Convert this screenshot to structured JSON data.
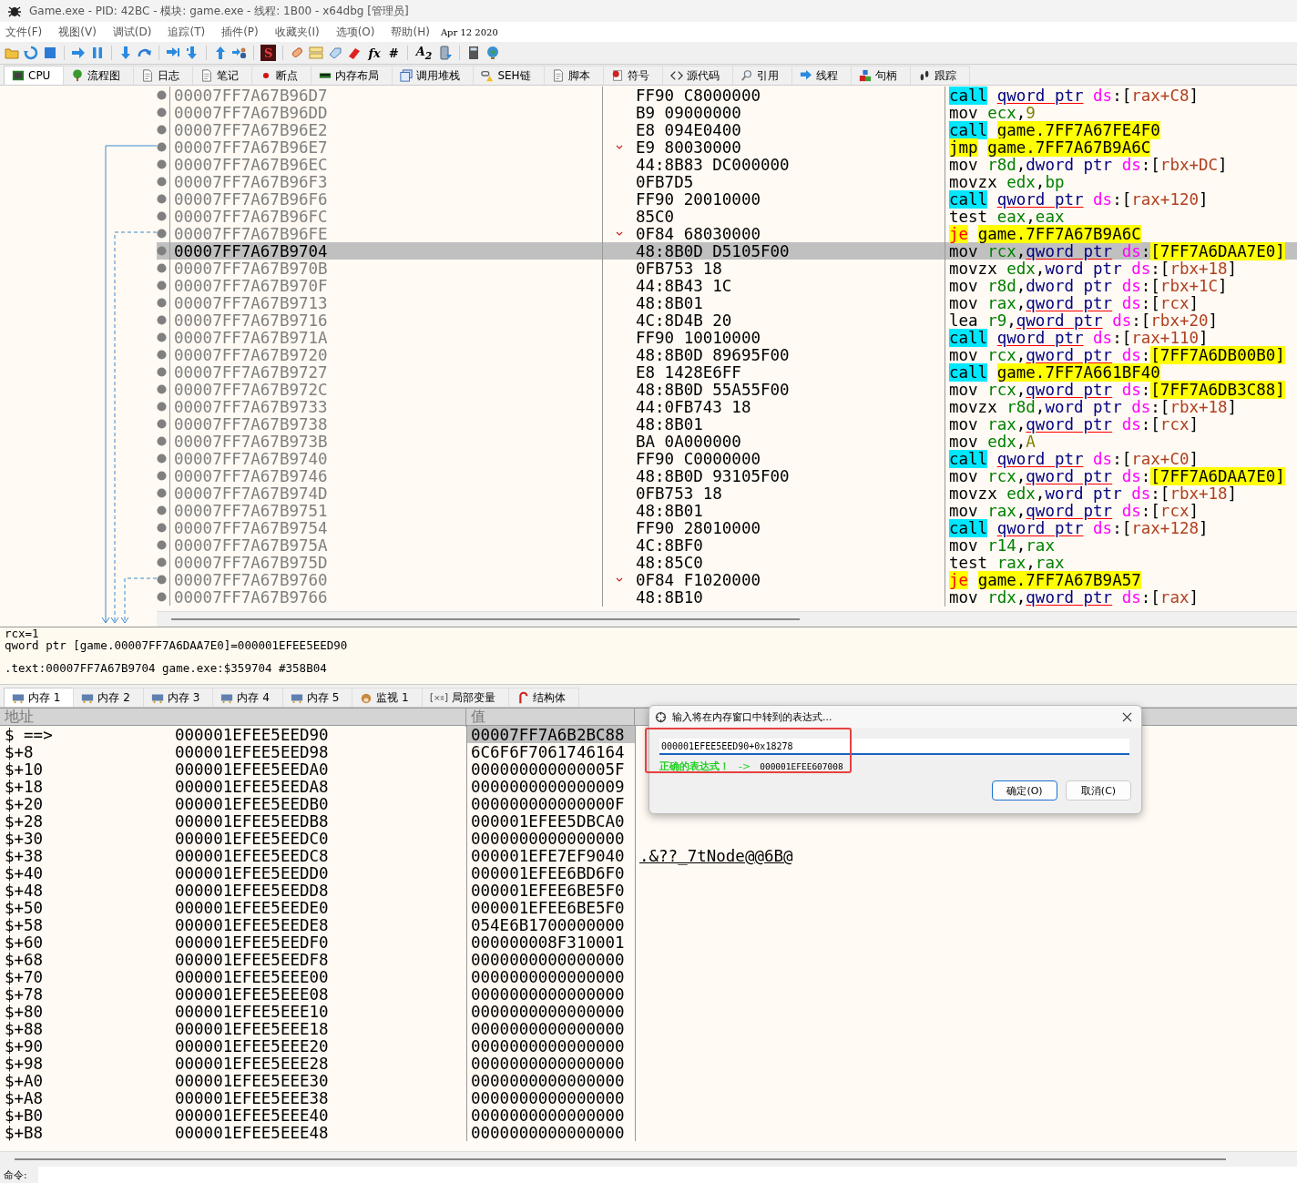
{
  "window": {
    "title": "Game.exe - PID: 42BC - 模块: game.exe - 线程: 1B00 - x64dbg [管理员]"
  },
  "menu": {
    "items": [
      "文件(F)",
      "视图(V)",
      "调试(D)",
      "追踪(T)",
      "插件(P)",
      "收藏夹(I)",
      "选项(O)",
      "帮助(H)"
    ],
    "build_date": "Apr 12 2020"
  },
  "toolbar": {
    "labels": [
      "S",
      "fx",
      "#",
      "A$_{2}$"
    ]
  },
  "tabs": [
    {
      "label": "CPU",
      "selected": true
    },
    {
      "label": "流程图",
      "selected": false
    },
    {
      "label": "日志",
      "selected": false
    },
    {
      "label": "笔记",
      "selected": false
    },
    {
      "label": "断点",
      "selected": false
    },
    {
      "label": "内存布局",
      "selected": false
    },
    {
      "label": "调用堆栈",
      "selected": false
    },
    {
      "label": "SEH链",
      "selected": false
    },
    {
      "label": "脚本",
      "selected": false
    },
    {
      "label": "符号",
      "selected": false
    },
    {
      "label": "源代码",
      "selected": false
    },
    {
      "label": "引用",
      "selected": false
    },
    {
      "label": "线程",
      "selected": false
    },
    {
      "label": "句柄",
      "selected": false
    },
    {
      "label": "跟踪",
      "selected": false
    }
  ],
  "disassembly": {
    "rows": [
      {
        "address": "00007FF7A67B96D7",
        "bytes": "FF90 C8000000",
        "jump_mark": false,
        "selected": false,
        "ins": [
          {
            "kind": "call",
            "text": "call"
          },
          {
            "kind": "qptr",
            "text": "qword ptr"
          },
          {
            "kind": "seg",
            "text": "ds"
          },
          {
            "kind": "p",
            "text": ":["
          },
          {
            "kind": "mem",
            "text": "rax+C8"
          },
          {
            "kind": "p",
            "text": "]"
          }
        ]
      },
      {
        "address": "00007FF7A67B96DD",
        "bytes": "B9 09000000",
        "jump_mark": false,
        "selected": false,
        "ins": [
          {
            "kind": "mn",
            "text": "mov"
          },
          {
            "kind": "reg",
            "text": "ecx"
          },
          {
            "kind": "p",
            "text": ","
          },
          {
            "kind": "imm",
            "text": "9"
          }
        ]
      },
      {
        "address": "00007FF7A67B96E2",
        "bytes": "E8 094E0400",
        "jump_mark": false,
        "selected": false,
        "ins": [
          {
            "kind": "call",
            "text": "call"
          },
          {
            "kind": "addr",
            "text": "game.7FF7A67FE4F0"
          }
        ]
      },
      {
        "address": "00007FF7A67B96E7",
        "bytes": "E9 80030000",
        "jump_mark": true,
        "selected": false,
        "ins": [
          {
            "kind": "jmp",
            "text": "jmp"
          },
          {
            "kind": "addr",
            "text": "game.7FF7A67B9A6C"
          }
        ]
      },
      {
        "address": "00007FF7A67B96EC",
        "bytes": "44:8B83 DC000000",
        "jump_mark": false,
        "selected": false,
        "ins": [
          {
            "kind": "mn",
            "text": "mov"
          },
          {
            "kind": "reg",
            "text": "r8d"
          },
          {
            "kind": "p",
            "text": ","
          },
          {
            "kind": "ptr",
            "text": "dword ptr"
          },
          {
            "kind": "seg",
            "text": "ds"
          },
          {
            "kind": "p",
            "text": ":["
          },
          {
            "kind": "mem",
            "text": "rbx+DC"
          },
          {
            "kind": "p",
            "text": "]"
          }
        ]
      },
      {
        "address": "00007FF7A67B96F3",
        "bytes": "0FB7D5",
        "jump_mark": false,
        "selected": false,
        "ins": [
          {
            "kind": "mn",
            "text": "movzx"
          },
          {
            "kind": "reg",
            "text": "edx"
          },
          {
            "kind": "p",
            "text": ","
          },
          {
            "kind": "reg",
            "text": "bp"
          }
        ]
      },
      {
        "address": "00007FF7A67B96F6",
        "bytes": "FF90 20010000",
        "jump_mark": false,
        "selected": false,
        "ins": [
          {
            "kind": "call",
            "text": "call"
          },
          {
            "kind": "qptr",
            "text": "qword ptr"
          },
          {
            "kind": "seg",
            "text": "ds"
          },
          {
            "kind": "p",
            "text": ":["
          },
          {
            "kind": "mem",
            "text": "rax+120"
          },
          {
            "kind": "p",
            "text": "]"
          }
        ]
      },
      {
        "address": "00007FF7A67B96FC",
        "bytes": "85C0",
        "jump_mark": false,
        "selected": false,
        "ins": [
          {
            "kind": "mn",
            "text": "test"
          },
          {
            "kind": "reg",
            "text": "eax"
          },
          {
            "kind": "p",
            "text": ","
          },
          {
            "kind": "reg",
            "text": "eax"
          }
        ]
      },
      {
        "address": "00007FF7A67B96FE",
        "bytes": "0F84 68030000",
        "jump_mark": true,
        "selected": false,
        "ins": [
          {
            "kind": "jcc",
            "text": "je"
          },
          {
            "kind": "addr",
            "text": "game.7FF7A67B9A6C"
          }
        ]
      },
      {
        "address": "00007FF7A67B9704",
        "bytes": "48:8B0D D5105F00",
        "jump_mark": false,
        "selected": true,
        "ins": [
          {
            "kind": "mn",
            "text": "mov"
          },
          {
            "kind": "reg",
            "text": "rcx"
          },
          {
            "kind": "p",
            "text": ","
          },
          {
            "kind": "qptr",
            "text": "qword ptr"
          },
          {
            "kind": "seg",
            "text": "ds"
          },
          {
            "kind": "p",
            "text": ":"
          },
          {
            "kind": "addr",
            "text": "[7FF7A6DAA7E0]"
          }
        ]
      },
      {
        "address": "00007FF7A67B970B",
        "bytes": "0FB753 18",
        "jump_mark": false,
        "selected": false,
        "ins": [
          {
            "kind": "mn",
            "text": "movzx"
          },
          {
            "kind": "reg",
            "text": "edx"
          },
          {
            "kind": "p",
            "text": ","
          },
          {
            "kind": "ptr",
            "text": "word ptr"
          },
          {
            "kind": "seg",
            "text": "ds"
          },
          {
            "kind": "p",
            "text": ":["
          },
          {
            "kind": "mem",
            "text": "rbx+18"
          },
          {
            "kind": "p",
            "text": "]"
          }
        ]
      },
      {
        "address": "00007FF7A67B970F",
        "bytes": "44:8B43 1C",
        "jump_mark": false,
        "selected": false,
        "ins": [
          {
            "kind": "mn",
            "text": "mov"
          },
          {
            "kind": "reg",
            "text": "r8d"
          },
          {
            "kind": "p",
            "text": ","
          },
          {
            "kind": "ptr",
            "text": "dword ptr"
          },
          {
            "kind": "seg",
            "text": "ds"
          },
          {
            "kind": "p",
            "text": ":["
          },
          {
            "kind": "mem",
            "text": "rbx+1C"
          },
          {
            "kind": "p",
            "text": "]"
          }
        ]
      },
      {
        "address": "00007FF7A67B9713",
        "bytes": "48:8B01",
        "jump_mark": false,
        "selected": false,
        "ins": [
          {
            "kind": "mn",
            "text": "mov"
          },
          {
            "kind": "reg",
            "text": "rax"
          },
          {
            "kind": "p",
            "text": ","
          },
          {
            "kind": "qptr",
            "text": "qword ptr"
          },
          {
            "kind": "seg",
            "text": "ds"
          },
          {
            "kind": "p",
            "text": ":["
          },
          {
            "kind": "mem",
            "text": "rcx"
          },
          {
            "kind": "p",
            "text": "]"
          }
        ]
      },
      {
        "address": "00007FF7A67B9716",
        "bytes": "4C:8D4B 20",
        "jump_mark": false,
        "selected": false,
        "ins": [
          {
            "kind": "mn",
            "text": "lea"
          },
          {
            "kind": "reg",
            "text": "r9"
          },
          {
            "kind": "p",
            "text": ","
          },
          {
            "kind": "qptr",
            "text": "qword ptr"
          },
          {
            "kind": "seg",
            "text": "ds"
          },
          {
            "kind": "p",
            "text": ":["
          },
          {
            "kind": "mem",
            "text": "rbx+20"
          },
          {
            "kind": "p",
            "text": "]"
          }
        ]
      },
      {
        "address": "00007FF7A67B971A",
        "bytes": "FF90 10010000",
        "jump_mark": false,
        "selected": false,
        "ins": [
          {
            "kind": "call",
            "text": "call"
          },
          {
            "kind": "qptr",
            "text": "qword ptr"
          },
          {
            "kind": "seg",
            "text": "ds"
          },
          {
            "kind": "p",
            "text": ":["
          },
          {
            "kind": "mem",
            "text": "rax+110"
          },
          {
            "kind": "p",
            "text": "]"
          }
        ]
      },
      {
        "address": "00007FF7A67B9720",
        "bytes": "48:8B0D 89695F00",
        "jump_mark": false,
        "selected": false,
        "ins": [
          {
            "kind": "mn",
            "text": "mov"
          },
          {
            "kind": "reg",
            "text": "rcx"
          },
          {
            "kind": "p",
            "text": ","
          },
          {
            "kind": "qptr",
            "text": "qword ptr"
          },
          {
            "kind": "seg",
            "text": "ds"
          },
          {
            "kind": "p",
            "text": ":"
          },
          {
            "kind": "addr",
            "text": "[7FF7A6DB00B0]"
          }
        ]
      },
      {
        "address": "00007FF7A67B9727",
        "bytes": "E8 1428E6FF",
        "jump_mark": false,
        "selected": false,
        "ins": [
          {
            "kind": "call",
            "text": "call"
          },
          {
            "kind": "addr",
            "text": "game.7FF7A661BF40"
          }
        ]
      },
      {
        "address": "00007FF7A67B972C",
        "bytes": "48:8B0D 55A55F00",
        "jump_mark": false,
        "selected": false,
        "ins": [
          {
            "kind": "mn",
            "text": "mov"
          },
          {
            "kind": "reg",
            "text": "rcx"
          },
          {
            "kind": "p",
            "text": ","
          },
          {
            "kind": "qptr",
            "text": "qword ptr"
          },
          {
            "kind": "seg",
            "text": "ds"
          },
          {
            "kind": "p",
            "text": ":"
          },
          {
            "kind": "addr",
            "text": "[7FF7A6DB3C88]"
          }
        ]
      },
      {
        "address": "00007FF7A67B9733",
        "bytes": "44:0FB743 18",
        "jump_mark": false,
        "selected": false,
        "ins": [
          {
            "kind": "mn",
            "text": "movzx"
          },
          {
            "kind": "reg",
            "text": "r8d"
          },
          {
            "kind": "p",
            "text": ","
          },
          {
            "kind": "ptr",
            "text": "word ptr"
          },
          {
            "kind": "seg",
            "text": "ds"
          },
          {
            "kind": "p",
            "text": ":["
          },
          {
            "kind": "mem",
            "text": "rbx+18"
          },
          {
            "kind": "p",
            "text": "]"
          }
        ]
      },
      {
        "address": "00007FF7A67B9738",
        "bytes": "48:8B01",
        "jump_mark": false,
        "selected": false,
        "ins": [
          {
            "kind": "mn",
            "text": "mov"
          },
          {
            "kind": "reg",
            "text": "rax"
          },
          {
            "kind": "p",
            "text": ","
          },
          {
            "kind": "qptr",
            "text": "qword ptr"
          },
          {
            "kind": "seg",
            "text": "ds"
          },
          {
            "kind": "p",
            "text": ":["
          },
          {
            "kind": "mem",
            "text": "rcx"
          },
          {
            "kind": "p",
            "text": "]"
          }
        ]
      },
      {
        "address": "00007FF7A67B973B",
        "bytes": "BA 0A000000",
        "jump_mark": false,
        "selected": false,
        "ins": [
          {
            "kind": "mn",
            "text": "mov"
          },
          {
            "kind": "reg",
            "text": "edx"
          },
          {
            "kind": "p",
            "text": ","
          },
          {
            "kind": "imm",
            "text": "A"
          }
        ]
      },
      {
        "address": "00007FF7A67B9740",
        "bytes": "FF90 C0000000",
        "jump_mark": false,
        "selected": false,
        "ins": [
          {
            "kind": "call",
            "text": "call"
          },
          {
            "kind": "qptr",
            "text": "qword ptr"
          },
          {
            "kind": "seg",
            "text": "ds"
          },
          {
            "kind": "p",
            "text": ":["
          },
          {
            "kind": "mem",
            "text": "rax+C0"
          },
          {
            "kind": "p",
            "text": "]"
          }
        ]
      },
      {
        "address": "00007FF7A67B9746",
        "bytes": "48:8B0D 93105F00",
        "jump_mark": false,
        "selected": false,
        "ins": [
          {
            "kind": "mn",
            "text": "mov"
          },
          {
            "kind": "reg",
            "text": "rcx"
          },
          {
            "kind": "p",
            "text": ","
          },
          {
            "kind": "qptr",
            "text": "qword ptr"
          },
          {
            "kind": "seg",
            "text": "ds"
          },
          {
            "kind": "p",
            "text": ":"
          },
          {
            "kind": "addr",
            "text": "[7FF7A6DAA7E0]"
          }
        ]
      },
      {
        "address": "00007FF7A67B974D",
        "bytes": "0FB753 18",
        "jump_mark": false,
        "selected": false,
        "ins": [
          {
            "kind": "mn",
            "text": "movzx"
          },
          {
            "kind": "reg",
            "text": "edx"
          },
          {
            "kind": "p",
            "text": ","
          },
          {
            "kind": "ptr",
            "text": "word ptr"
          },
          {
            "kind": "seg",
            "text": "ds"
          },
          {
            "kind": "p",
            "text": ":["
          },
          {
            "kind": "mem",
            "text": "rbx+18"
          },
          {
            "kind": "p",
            "text": "]"
          }
        ]
      },
      {
        "address": "00007FF7A67B9751",
        "bytes": "48:8B01",
        "jump_mark": false,
        "selected": false,
        "ins": [
          {
            "kind": "mn",
            "text": "mov"
          },
          {
            "kind": "reg",
            "text": "rax"
          },
          {
            "kind": "p",
            "text": ","
          },
          {
            "kind": "qptr",
            "text": "qword ptr"
          },
          {
            "kind": "seg",
            "text": "ds"
          },
          {
            "kind": "p",
            "text": ":["
          },
          {
            "kind": "mem",
            "text": "rcx"
          },
          {
            "kind": "p",
            "text": "]"
          }
        ]
      },
      {
        "address": "00007FF7A67B9754",
        "bytes": "FF90 28010000",
        "jump_mark": false,
        "selected": false,
        "ins": [
          {
            "kind": "call",
            "text": "call"
          },
          {
            "kind": "qptr",
            "text": "qword ptr"
          },
          {
            "kind": "seg",
            "text": "ds"
          },
          {
            "kind": "p",
            "text": ":["
          },
          {
            "kind": "mem",
            "text": "rax+128"
          },
          {
            "kind": "p",
            "text": "]"
          }
        ]
      },
      {
        "address": "00007FF7A67B975A",
        "bytes": "4C:8BF0",
        "jump_mark": false,
        "selected": false,
        "ins": [
          {
            "kind": "mn",
            "text": "mov"
          },
          {
            "kind": "reg",
            "text": "r14"
          },
          {
            "kind": "p",
            "text": ","
          },
          {
            "kind": "reg",
            "text": "rax"
          }
        ]
      },
      {
        "address": "00007FF7A67B975D",
        "bytes": "48:85C0",
        "jump_mark": false,
        "selected": false,
        "ins": [
          {
            "kind": "mn",
            "text": "test"
          },
          {
            "kind": "reg",
            "text": "rax"
          },
          {
            "kind": "p",
            "text": ","
          },
          {
            "kind": "reg",
            "text": "rax"
          }
        ]
      },
      {
        "address": "00007FF7A67B9760",
        "bytes": "0F84 F1020000",
        "jump_mark": true,
        "selected": false,
        "ins": [
          {
            "kind": "jcc",
            "text": "je"
          },
          {
            "kind": "addr",
            "text": "game.7FF7A67B9A57"
          }
        ]
      },
      {
        "address": "00007FF7A67B9766",
        "bytes": "48:8B10",
        "jump_mark": false,
        "selected": false,
        "ins": [
          {
            "kind": "mn",
            "text": "mov"
          },
          {
            "kind": "reg",
            "text": "rdx"
          },
          {
            "kind": "p",
            "text": ","
          },
          {
            "kind": "qptr",
            "text": "qword ptr"
          },
          {
            "kind": "seg",
            "text": "ds"
          },
          {
            "kind": "p",
            "text": ":["
          },
          {
            "kind": "mem",
            "text": "rax"
          },
          {
            "kind": "p",
            "text": "]"
          }
        ]
      }
    ]
  },
  "info": {
    "groups": [
      [
        "rcx=1",
        "qword ptr [game.00007FF7A6DAA7E0]=000001EFEE5EED90"
      ],
      [
        ".text:00007FF7A67B9704 game.exe:$359704 #358B04"
      ]
    ]
  },
  "bottom_tabs": [
    {
      "label": "内存 1",
      "selected": true
    },
    {
      "label": "内存 2",
      "selected": false
    },
    {
      "label": "内存 3",
      "selected": false
    },
    {
      "label": "内存 4",
      "selected": false
    },
    {
      "label": "内存 5",
      "selected": false
    },
    {
      "label": "监视 1",
      "selected": false
    },
    {
      "label": "局部变量",
      "selected": false
    },
    {
      "label": "结构体",
      "selected": false
    }
  ],
  "dump": {
    "columns": [
      "地址",
      "值"
    ],
    "rows": [
      {
        "offset": "$ ==>",
        "address": "000001EFEE5EED90",
        "value": "00007FF7A6B2BC88",
        "selected": true
      },
      {
        "offset": "$+8",
        "address": "000001EFEE5EED98",
        "value": "6C6F6F7061746164",
        "selected": false
      },
      {
        "offset": "$+10",
        "address": "000001EFEE5EEDA0",
        "value": "000000000000005F",
        "selected": false
      },
      {
        "offset": "$+18",
        "address": "000001EFEE5EEDA8",
        "value": "0000000000000009",
        "selected": false
      },
      {
        "offset": "$+20",
        "address": "000001EFEE5EEDB0",
        "value": "000000000000000F",
        "selected": false
      },
      {
        "offset": "$+28",
        "address": "000001EFEE5EEDB8",
        "value": "000001EFEE5DBCA0",
        "selected": false
      },
      {
        "offset": "$+30",
        "address": "000001EFEE5EEDC0",
        "value": "0000000000000000",
        "selected": false
      },
      {
        "offset": "$+38",
        "address": "000001EFEE5EEDC8",
        "value": "000001EFE7EF9040",
        "selected": false,
        "comment": ".&??_7tNode@@6B@"
      },
      {
        "offset": "$+40",
        "address": "000001EFEE5EEDD0",
        "value": "000001EFEE6BD6F0",
        "selected": false
      },
      {
        "offset": "$+48",
        "address": "000001EFEE5EEDD8",
        "value": "000001EFEE6BE5F0",
        "selected": false
      },
      {
        "offset": "$+50",
        "address": "000001EFEE5EEDE0",
        "value": "000001EFEE6BE5F0",
        "selected": false
      },
      {
        "offset": "$+58",
        "address": "000001EFEE5EEDE8",
        "value": "054E6B1700000000",
        "selected": false
      },
      {
        "offset": "$+60",
        "address": "000001EFEE5EEDF0",
        "value": "000000008F310001",
        "selected": false
      },
      {
        "offset": "$+68",
        "address": "000001EFEE5EEDF8",
        "value": "0000000000000000",
        "selected": false
      },
      {
        "offset": "$+70",
        "address": "000001EFEE5EEE00",
        "value": "0000000000000000",
        "selected": false
      },
      {
        "offset": "$+78",
        "address": "000001EFEE5EEE08",
        "value": "0000000000000000",
        "selected": false
      },
      {
        "offset": "$+80",
        "address": "000001EFEE5EEE10",
        "value": "0000000000000000",
        "selected": false
      },
      {
        "offset": "$+88",
        "address": "000001EFEE5EEE18",
        "value": "0000000000000000",
        "selected": false
      },
      {
        "offset": "$+90",
        "address": "000001EFEE5EEE20",
        "value": "0000000000000000",
        "selected": false
      },
      {
        "offset": "$+98",
        "address": "000001EFEE5EEE28",
        "value": "0000000000000000",
        "selected": false
      },
      {
        "offset": "$+A0",
        "address": "000001EFEE5EEE30",
        "value": "0000000000000000",
        "selected": false
      },
      {
        "offset": "$+A8",
        "address": "000001EFEE5EEE38",
        "value": "0000000000000000",
        "selected": false
      },
      {
        "offset": "$+B0",
        "address": "000001EFEE5EEE40",
        "value": "0000000000000000",
        "selected": false
      },
      {
        "offset": "$+B8",
        "address": "000001EFEE5EEE48",
        "value": "0000000000000000",
        "selected": false
      }
    ]
  },
  "dialog": {
    "title": "输入将在内存窗口中转到的表达式...",
    "value": "000001EFEE5EED90+0x18278",
    "status": "正确的表达式！",
    "arrow": "->",
    "result": "000001EFEE607008",
    "buttons": [
      {
        "label": "确定(O)",
        "default": true
      },
      {
        "label": "取消(C)",
        "default": false
      }
    ]
  },
  "command": {
    "label": "命令:"
  }
}
